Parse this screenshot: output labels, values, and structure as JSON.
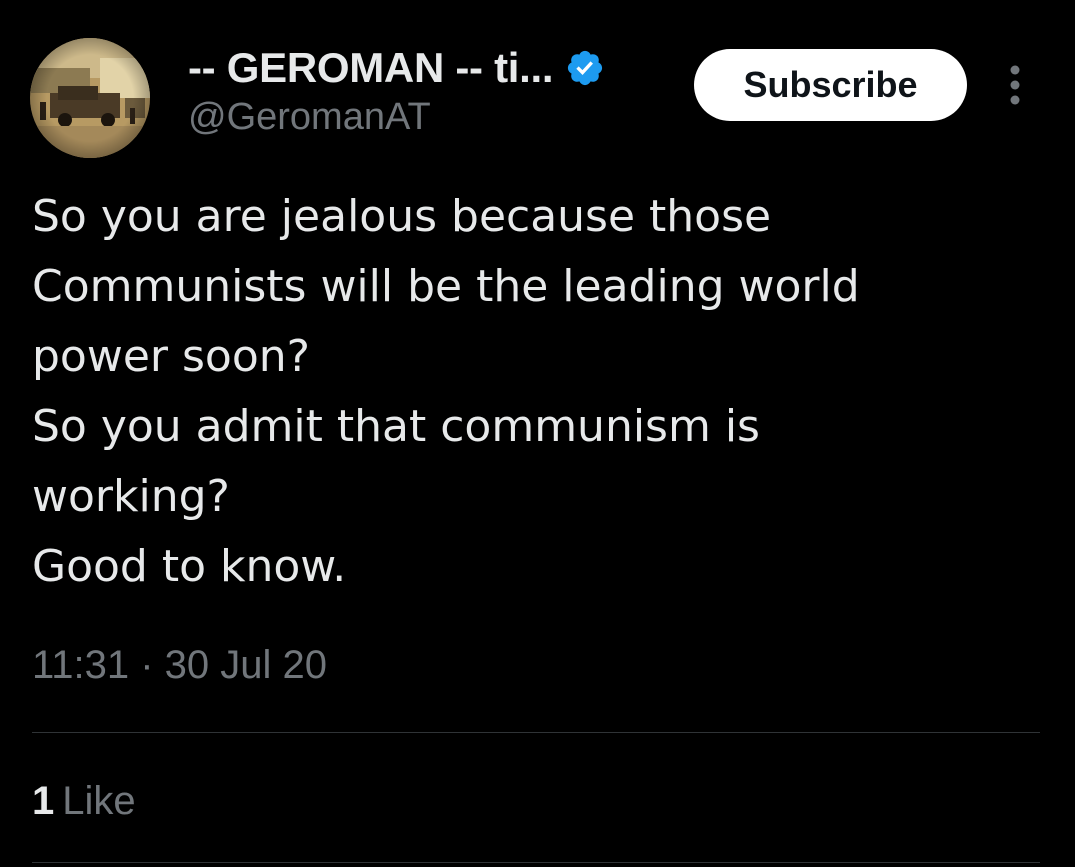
{
  "tweet": {
    "author": {
      "display_name": "-- GEROMAN -- ti...",
      "handle": "@GeromanAT",
      "verified_icon": "verified-badge-icon",
      "avatar": "profile-photo"
    },
    "subscribe_label": "Subscribe",
    "more_icon": "more-vertical-icon",
    "text": "So you are jealous because those\nCommunists will be the leading world\npower soon?\nSo you admit that communism is\nworking?\nGood to know.",
    "timestamp": "11:31 · 30 Jul 20",
    "likes": {
      "count": "1",
      "label": "Like"
    }
  },
  "colors": {
    "background": "#000000",
    "primary_text": "#e7e9ea",
    "secondary_text": "#71767b",
    "verified_blue": "#1d9bf0",
    "button_bg": "#ffffff",
    "divider": "#2f3336"
  }
}
